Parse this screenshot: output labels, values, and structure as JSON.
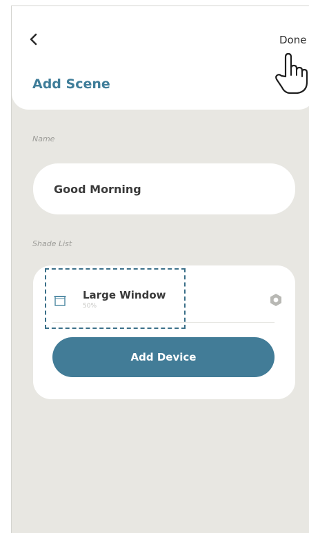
{
  "header": {
    "back_icon": "chevron-left-icon",
    "done_label": "Done",
    "title": "Add Scene",
    "cursor_icon": "hand-pointer-icon"
  },
  "name_section": {
    "label": "Name",
    "value": "Good Morning"
  },
  "shade_section": {
    "label": "Shade List",
    "devices": [
      {
        "name": "Large Window",
        "level": "50%",
        "icon": "window-shade-icon",
        "action_icon": "hexagon-settings-icon"
      }
    ],
    "add_button_label": "Add Device"
  },
  "colors": {
    "accent": "#427c97",
    "title": "#3f7d99",
    "background": "#e8e7e2",
    "card": "#ffffff"
  }
}
